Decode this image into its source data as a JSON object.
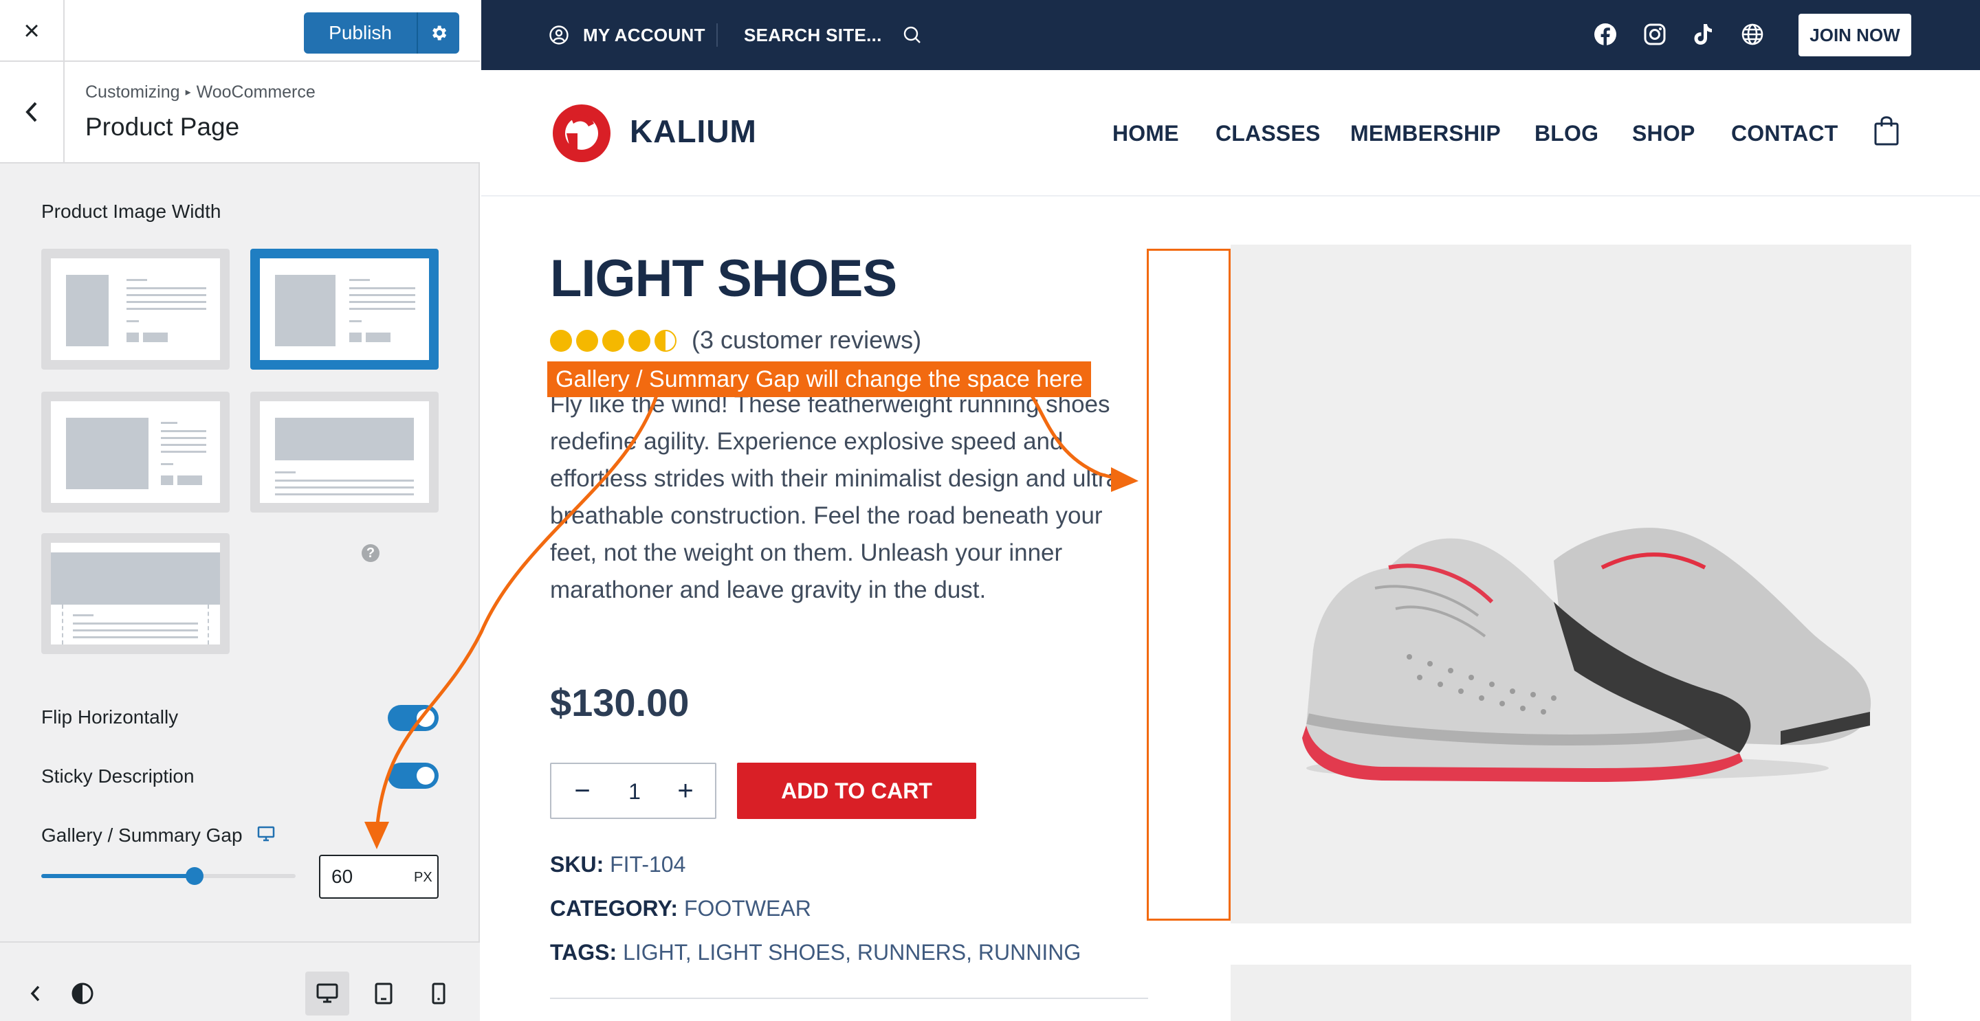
{
  "customizer": {
    "publish_label": "Publish",
    "breadcrumb_root": "Customizing",
    "breadcrumb_sep": "▸",
    "breadcrumb_section": "WooCommerce",
    "section_title": "Product Page",
    "product_image_width_label": "Product Image Width",
    "layout_options_selected": 2,
    "flip_horizontally_label": "Flip Horizontally",
    "flip_horizontally_on": true,
    "sticky_description_label": "Sticky Description",
    "sticky_description_on": true,
    "gap_label": "Gallery / Summary Gap",
    "gap_value": "60",
    "gap_unit": "PX",
    "gap_slider_fraction": 0.6,
    "help_glyph": "?",
    "accent_color": "#2271b1"
  },
  "topbar": {
    "my_account": "MY ACCOUNT",
    "search": "SEARCH SITE...",
    "join_now": "JOIN NOW"
  },
  "header": {
    "logo": "KALIUM",
    "nav": [
      "HOME",
      "CLASSES",
      "MEMBERSHIP",
      "BLOG",
      "SHOP",
      "CONTACT"
    ]
  },
  "product": {
    "title": "LIGHT SHOES",
    "rating": 4.5,
    "reviews": "(3 customer reviews)",
    "description": "Fly like the wind! These featherweight running shoes redefine agility. Experience explosive speed and effortless strides with their minimalist design and ultra-breathable construction. Feel the road beneath your feet, not the weight on them. Unleash your inner marathoner and leave gravity in the dust.",
    "price": "$130.00",
    "quantity": "1",
    "qty_minus": "−",
    "qty_plus": "+",
    "add_to_cart": "ADD TO CART",
    "sku_label": "SKU:",
    "sku": "FIT-104",
    "category_label": "CATEGORY:",
    "category": "FOOTWEAR",
    "tags_label": "TAGS:",
    "tags": "LIGHT, LIGHT SHOES, RUNNERS, RUNNING"
  },
  "annotation": {
    "text": "Gallery / Summary Gap will change the space here",
    "color": "#f26a10"
  },
  "icons": {
    "close": "×",
    "back": "chevron-left",
    "gear": "gear",
    "account": "user-circle",
    "search": "magnifier",
    "social": [
      "facebook",
      "instagram",
      "tiktok",
      "globe"
    ],
    "cart": "shopping-bag"
  }
}
